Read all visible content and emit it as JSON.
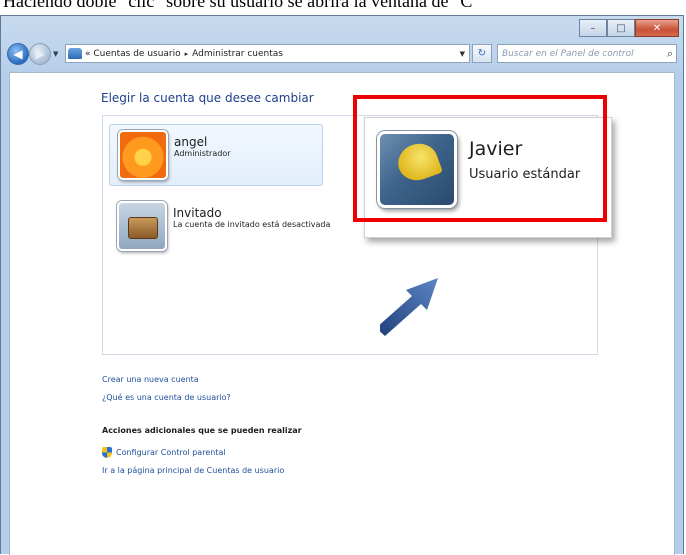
{
  "caption": "Haciendo doble \"clic\" sobre su usuario se abrirá la ventana de \"C",
  "window": {
    "minimize_label": "–",
    "maximize_label": "□",
    "close_label": "✕"
  },
  "nav": {
    "back_icon": "◀",
    "forward_icon": "▶",
    "breadcrumb_prefix": "«",
    "breadcrumb": [
      "Cuentas de usuario",
      "Administrar cuentas"
    ],
    "separator": "▸",
    "refresh_icon": "↻",
    "search_placeholder": "Buscar en el Panel de control",
    "search_icon": "⌕"
  },
  "main": {
    "heading": "Elegir la cuenta que desee cambiar",
    "accounts": [
      {
        "name": "angel",
        "role": "Administrador"
      },
      {
        "name": "Invitado",
        "role": "La cuenta de invitado está desactivada"
      }
    ],
    "highlight": {
      "name": "Javier",
      "role": "Usuario estándar"
    },
    "links": [
      "Crear una nueva cuenta",
      "¿Qué es una cuenta de usuario?"
    ],
    "additional_heading": "Acciones adicionales que se pueden realizar",
    "additional_links": [
      "Configurar Control parental",
      "Ir a la página principal de Cuentas de usuario"
    ]
  },
  "colors": {
    "highlight_border": "#ee0000",
    "link": "#1f4f9b",
    "heading": "#1e3f8b"
  }
}
